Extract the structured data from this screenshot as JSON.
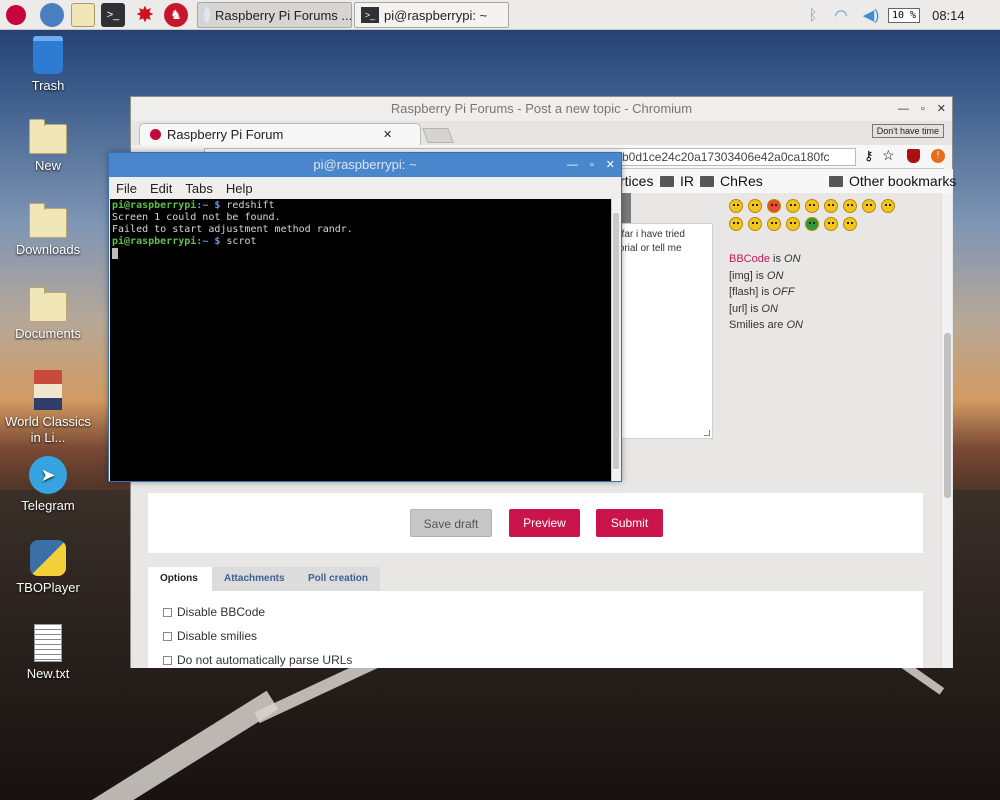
{
  "taskbar": {
    "tasks": [
      {
        "label": "Raspberry Pi Forums ...",
        "icon": "chromium-icon"
      },
      {
        "label": "pi@raspberrypi: ~",
        "icon": "terminal-icon"
      }
    ],
    "battery": "10 %",
    "clock": "08:14"
  },
  "desktop": {
    "icons": [
      {
        "label": "Trash"
      },
      {
        "label": "New"
      },
      {
        "label": "Downloads"
      },
      {
        "label": "Documents"
      },
      {
        "label": "World Classics in Li..."
      },
      {
        "label": "Telegram"
      },
      {
        "label": "TBOPlayer"
      },
      {
        "label": "New.txt"
      }
    ]
  },
  "chromium": {
    "window_title": "Raspberry Pi Forums - Post a new topic - Chromium",
    "tab_title": "Raspberry Pi Forum",
    "extension_badge": "Don't have time",
    "url_visible": "=b0d1ce24c20a17303406e42a0ca180fc",
    "bookmarks": [
      {
        "label": "rtices"
      },
      {
        "label": "IR"
      },
      {
        "label": "ChRes"
      },
      {
        "label": "Other bookmarks"
      }
    ],
    "editor_text": ": far i have tried\ntorial or tell me",
    "bbcode_status": [
      {
        "name": "BBCode",
        "is": " is ",
        "value": "ON"
      },
      {
        "name": "[img]",
        "is": " is ",
        "value": "ON"
      },
      {
        "name": "[flash]",
        "is": " is ",
        "value": "OFF"
      },
      {
        "name": "[url]",
        "is": " is ",
        "value": "ON"
      },
      {
        "name": "Smilies",
        "is": " are ",
        "value": "ON"
      }
    ],
    "buttons": {
      "save_draft": "Save draft",
      "preview": "Preview",
      "submit": "Submit"
    },
    "option_tabs": [
      "Options",
      "Attachments",
      "Poll creation"
    ],
    "options": [
      "Disable BBCode",
      "Disable smilies",
      "Do not automatically parse URLs"
    ]
  },
  "terminal": {
    "window_title": "pi@raspberrypi: ~",
    "menu": [
      "File",
      "Edit",
      "Tabs",
      "Help"
    ],
    "prompt_user": "pi@raspberrypi",
    "prompt_path": ":~ $ ",
    "lines": {
      "cmd1": "redshift",
      "out1": "Screen 1 could not be found.",
      "out2": "Failed to start adjustment method randr.",
      "cmd2": "scrot"
    }
  }
}
